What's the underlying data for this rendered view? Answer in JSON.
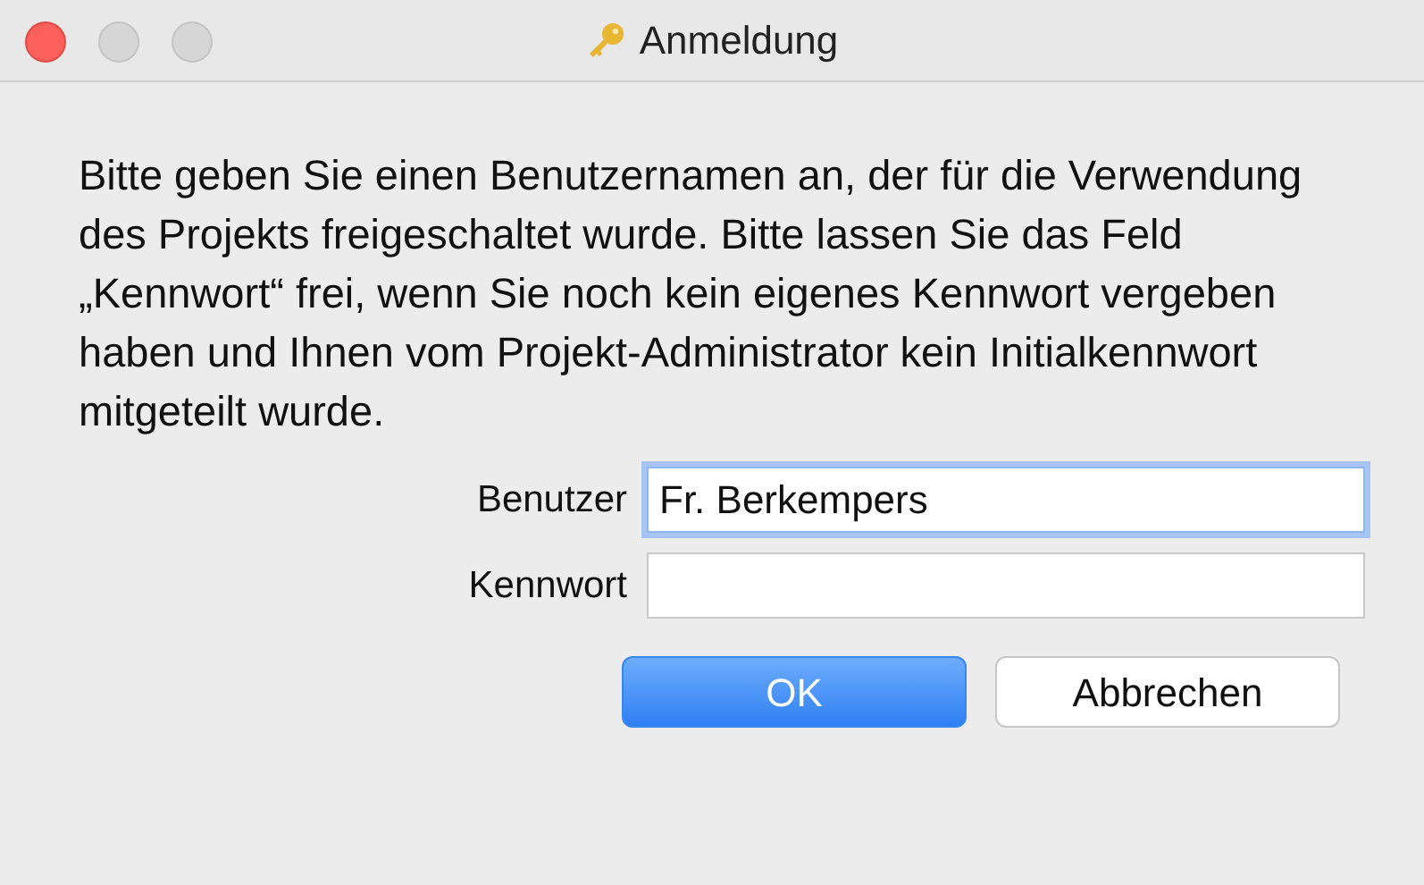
{
  "window": {
    "title": "Anmeldung"
  },
  "message": "Bitte geben Sie einen Benutzernamen an, der für die Verwendung des Projekts freigeschaltet wurde. Bitte lassen Sie das Feld „Kennwort“ frei, wenn Sie noch kein eigenes Kennwort vergeben haben und Ihnen vom Projekt-Administrator kein Initialkennwort mitgeteilt wurde.",
  "fields": [
    {
      "label": "Benutzer",
      "value": "Fr. Berkempers",
      "focused": true
    },
    {
      "label": "Kennwort",
      "focused": false
    }
  ],
  "buttons": [
    {
      "label": "OK",
      "kind": "default"
    },
    {
      "label": "Abbrechen",
      "kind": "normal"
    }
  ]
}
